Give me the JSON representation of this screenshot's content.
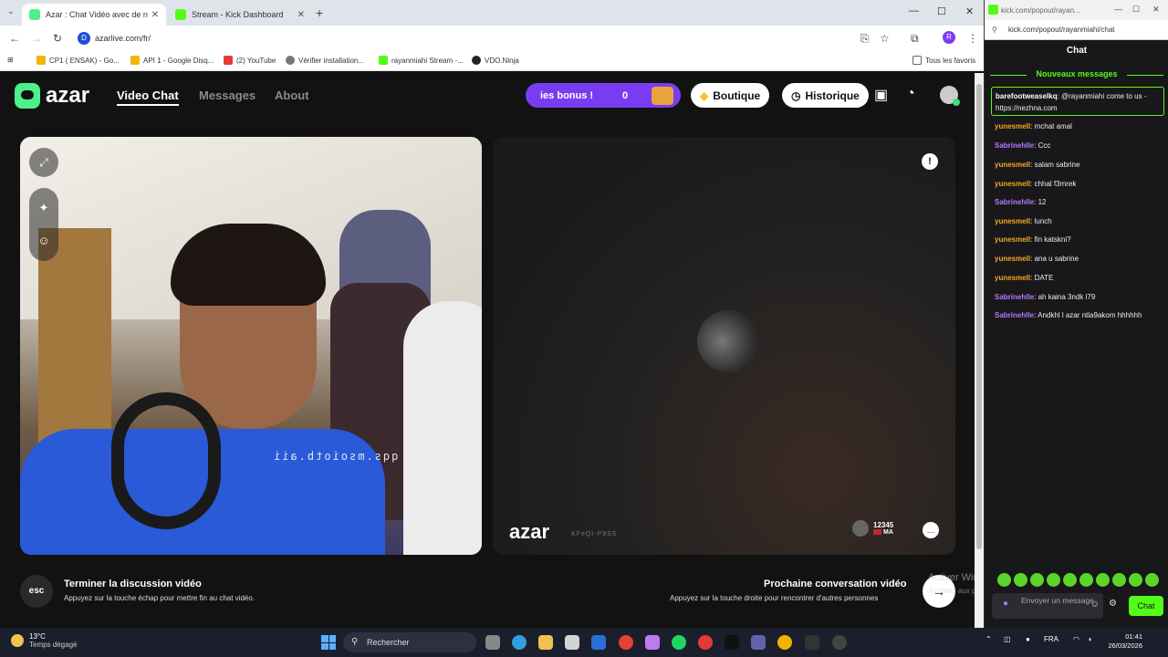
{
  "browser": {
    "tab_active_title": "Azar : Chat Vidéo avec de n",
    "tab_2_title": "Stream - Kick Dashboard",
    "url": "azarlive.com/fr/",
    "bookmarks": [
      "CP1 ( ENSAK) - Go...",
      "API 1 - Google Disq...",
      "(2) YouTube",
      "Vérifier installation...",
      "rayanmiahi Stream -...",
      "VDO.Ninja"
    ],
    "all_bookmarks": "Tous les favoris"
  },
  "azar": {
    "logo": "azar",
    "nav": [
      "Video Chat",
      "Messages",
      "About"
    ],
    "bonus_text": "ies bonus !",
    "bonus_count": "0",
    "shop_label": "Boutique",
    "history_label": "Historique",
    "partner_brand": "azar",
    "partner_id": "KFeQI-P9SS",
    "partner_name": "12345",
    "partner_country": "MA",
    "mirror_text": "qqs.msoiotb.aii",
    "esc_key": "esc",
    "end_title": "Terminer la discussion vidéo",
    "end_sub": "Appuyez sur la touche échap pour mettre fin au chat vidéo.",
    "next_title": "Prochaine conversation vidéo",
    "next_sub": "Appuyez sur la touche droite pour rencontrer d'autres personnes",
    "activate_title": "Activer Windows",
    "activate_sub": "Accédez aux paramètres pour activer Windows."
  },
  "kick": {
    "window_url": "kick.com/popout/rayan...",
    "url": "kick.com/popout/rayanmiahi/chat",
    "title": "Chat",
    "new_messages": "Nouveaux messages",
    "highlight": {
      "user": "barefootweaselkq",
      "text": ": @rayanmiahi come to us - https://nezhna.com"
    },
    "messages": [
      {
        "user": "yunesmell",
        "text": ": mchat amal",
        "color": "#f5a623"
      },
      {
        "user": "Sabrinehlle",
        "text": ": Ccc",
        "color": "#b27aff"
      },
      {
        "user": "yunesmell",
        "text": ": salam sabrine",
        "color": "#f5a623"
      },
      {
        "user": "yunesmell",
        "text": ": chhal f3mrek",
        "color": "#f5a623"
      },
      {
        "user": "Sabrinehlle",
        "text": ": 12",
        "color": "#b27aff"
      },
      {
        "user": "yunesmell",
        "text": ": lunch",
        "color": "#f5a623"
      },
      {
        "user": "yunesmell",
        "text": ": fin katskni?",
        "color": "#f5a623"
      },
      {
        "user": "yunesmell",
        "text": ": ana u sabrine",
        "color": "#f5a623"
      },
      {
        "user": "yunesmell",
        "text": ": DATE",
        "color": "#f5a623"
      },
      {
        "user": "Sabrinehlle",
        "text": ": ah kaina 3ndk l79",
        "color": "#b27aff"
      },
      {
        "user": "Sabrinehlle",
        "text": ": Andkhl l azar ntla9akom hhhhhh",
        "color": "#b27aff"
      }
    ],
    "input_placeholder": "Envoyer un message",
    "send_label": "Chat",
    "accent": "#53fc18"
  },
  "taskbar": {
    "temp": "13°C",
    "weather": "Temps dégagé",
    "search": "Rechercher",
    "lang": "FRA",
    "time": "01:41",
    "date": "26/03/2026"
  }
}
